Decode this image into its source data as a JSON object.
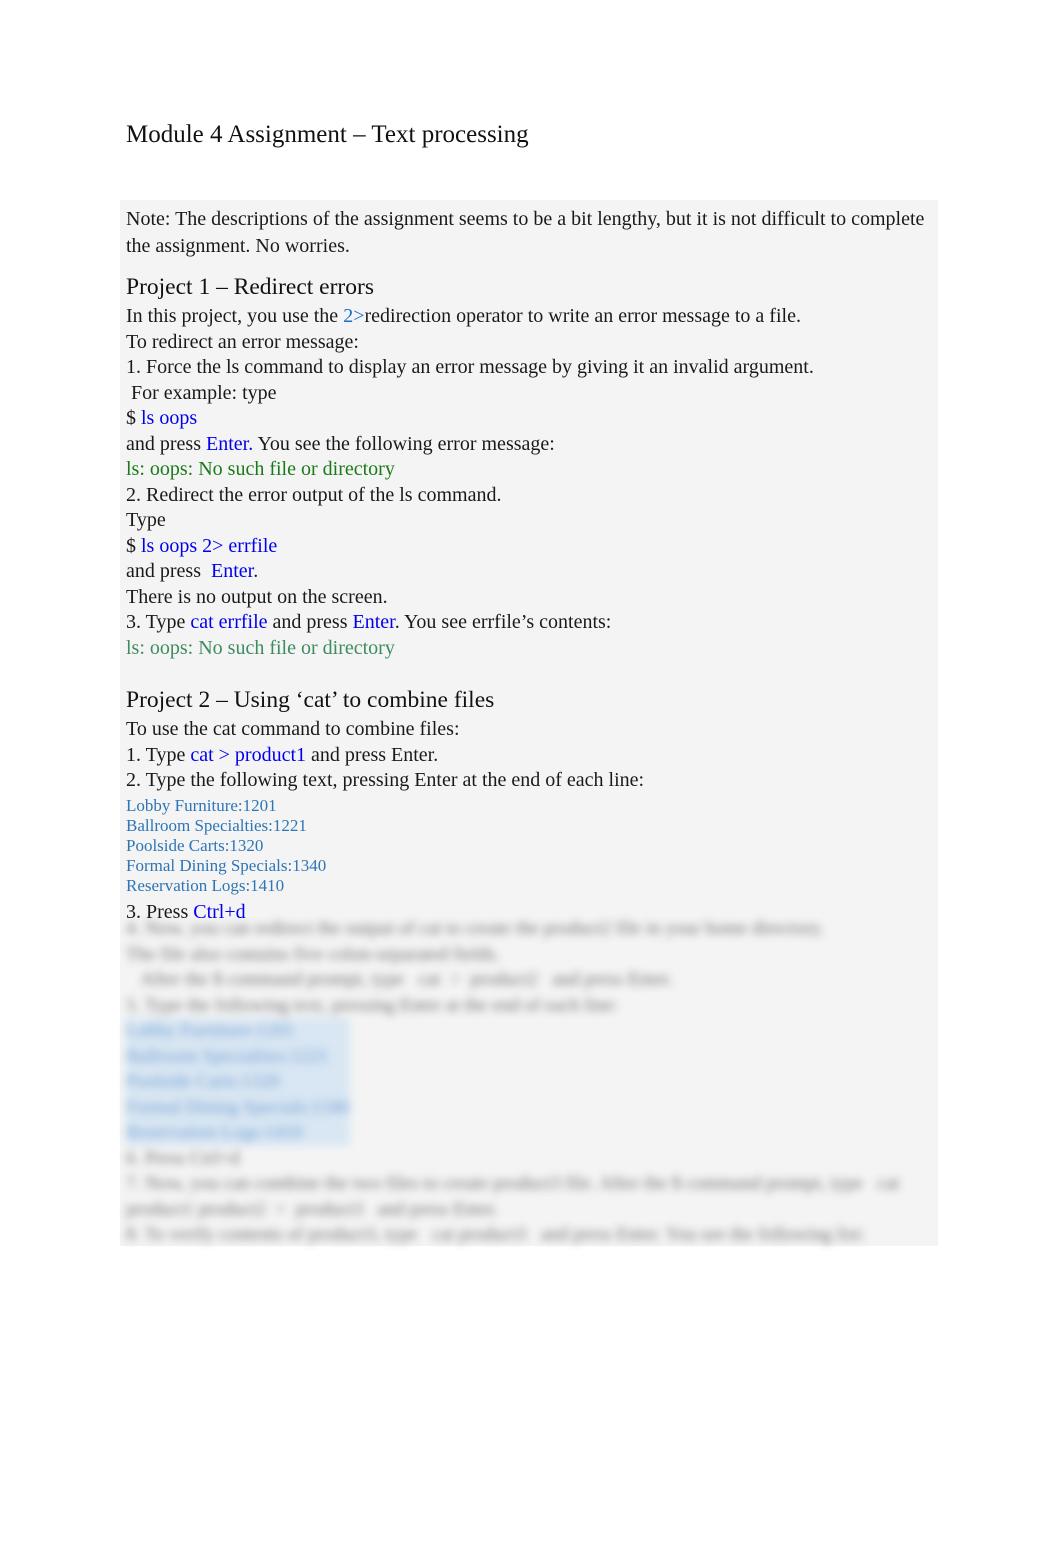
{
  "document": {
    "title": "Module 4 Assignment – Text processing",
    "note": "Note: The descriptions of the assignment seems to be a bit lengthy, but it is not difficult to complete the assignment. No worries.",
    "colors": {
      "command_blue": "#0000ee",
      "operator_blue": "#1a70c8",
      "error_green": "#1a7a1a",
      "error_green_alt": "#3d8b5f",
      "list_blue": "#2e75b6",
      "panel_gray": "#f2f2f2",
      "highlight_blue": "#cfe2f3",
      "highlight_purple": "#c9c8f7"
    }
  },
  "project1": {
    "heading": "Project 1 – Redirect errors",
    "intro_a": "In this project, you use the ",
    "intro_op": "2>",
    "intro_b": "redirection operator to write an error message to a file.",
    "steps_lead": "To redirect an error message:",
    "step1": "1. Force the ls command to display an error message by giving it an invalid argument.",
    "step1_cont": " For example: type",
    "cmd1_prompt": "$ ",
    "cmd1": "ls oops",
    "after1_a": "and press ",
    "after1_key": "Enter.",
    "after1_b": " You see the following error message:",
    "error_output": "ls: oops: No such file or directory",
    "step2": "2. Redirect the error output of the ls command.",
    "type_label": "Type",
    "cmd2_prompt": "$ ",
    "cmd2": "ls oops 2> errfile",
    "after2_a": "and press  ",
    "after2_key": "Enter",
    "after2_b": ".",
    "no_output": "There is no output on the screen.",
    "step3_a": "3. Type ",
    "step3_cmd": "cat errfile",
    "step3_b": " and press ",
    "step3_key": "Enter",
    "step3_c": ". You see errfile’s contents:",
    "error_output2": "ls: oops: No such file or directory"
  },
  "project2": {
    "heading": "Project 2 – Using ‘cat’ to combine files",
    "lead": "To use the cat command to combine files:",
    "step1_a": "1. Type ",
    "step1_cmd": "cat > product1",
    "step1_b": " and press Enter.",
    "step2": "2. Type the following text, pressing Enter at the end of each line:",
    "typed_lines": [
      "Lobby Furniture:1201",
      "Ballroom Specialties:1221",
      "Poolside Carts:1320",
      "Formal Dining Specials:1340",
      "Reservation Logs:1410"
    ],
    "step3_a": "3. Press ",
    "step3_key": "Ctrl+d"
  },
  "obscured_tail": {
    "note": "Remaining instructions are visually blurred / illegible in the screenshot.",
    "lines": [
      "4. Now, you can redirect the output of cat to create the product2 file in your home directory.",
      "The file also contains five colon-separated fields.",
      "   After the $ command prompt, type   cat  >  product2   and press Enter.",
      "5. Type the following text, pressing Enter at the end of each line:",
      "6. Press Ctrl+d",
      "7. Now, you can combine the two files to create product3 file. After the $ command prompt, type   cat product1 product2  >  product3   and press Enter.",
      "8. To verify contents of product3, type   cat product3   and press Enter. You see the following list:"
    ]
  }
}
